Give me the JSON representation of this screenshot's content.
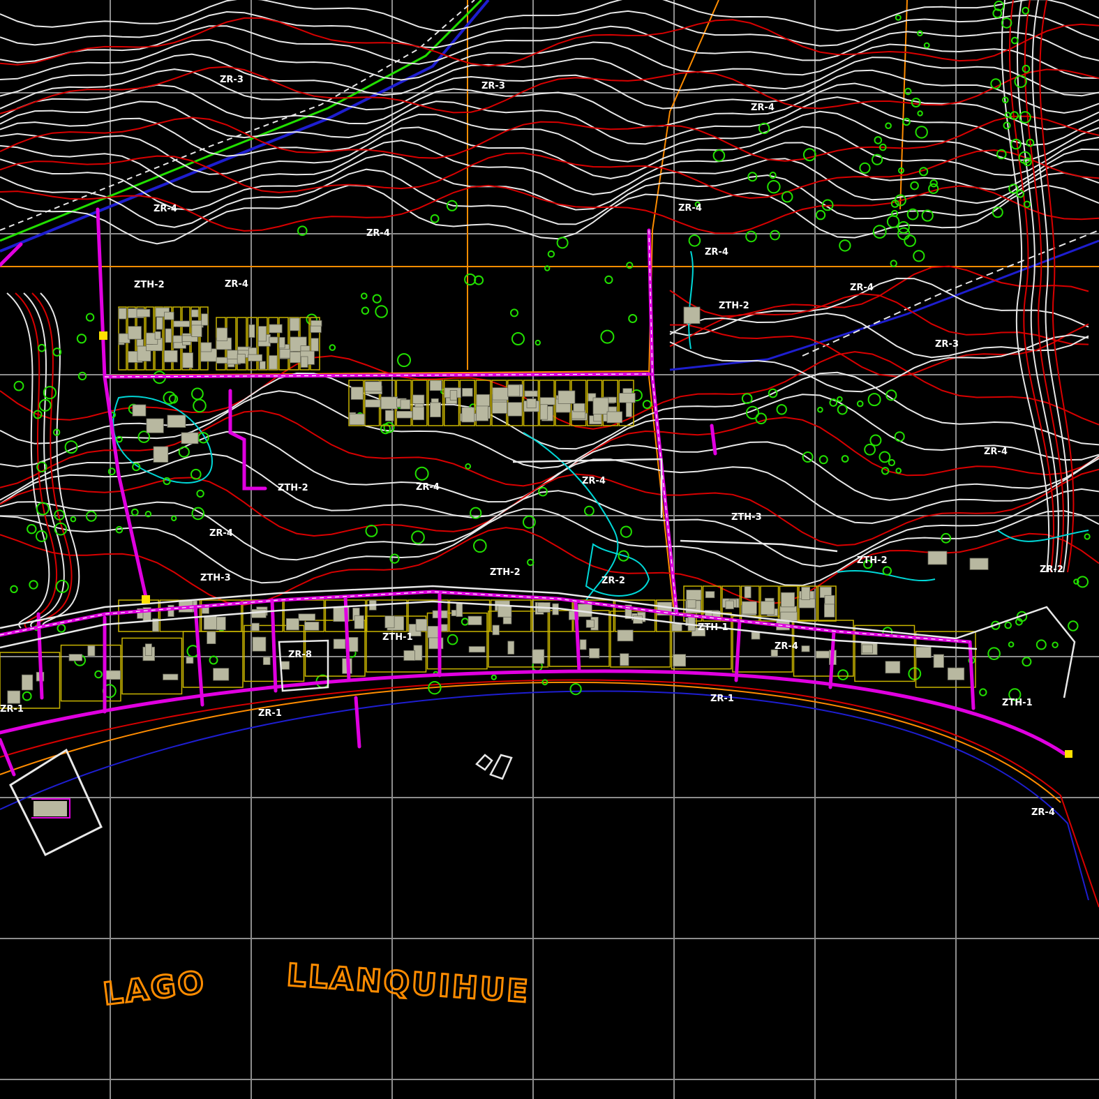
{
  "map": {
    "lake_words": [
      "LAGO",
      "LLANQUIHUE"
    ],
    "zone_labels": [
      "ZR-3",
      "ZR-3",
      "ZR-4",
      "ZR-4",
      "ZR-4",
      "ZR-4",
      "ZR-4",
      "ZR-4",
      "ZR-4",
      "ZR-4",
      "ZR-4",
      "ZR-4",
      "ZR-4",
      "ZR-4",
      "ZR-1",
      "ZR-1",
      "ZR-1",
      "ZR-4",
      "ZR-2",
      "ZR-2",
      "ZR-3",
      "ZR-8",
      "ZTH-2",
      "ZTH-2",
      "ZTH-2",
      "ZTH-2",
      "ZTH-2",
      "ZTH-1",
      "ZTH-1",
      "ZTH-1",
      "ZTH-3",
      "ZTH-3"
    ],
    "colors": {
      "background": "#000000",
      "grid": "#bdbdbd",
      "contour_major": "#e8e8e8",
      "contour_red": "#d80000",
      "vegetation": "#22e000",
      "roads": "#e000e0",
      "highway": "#1e1ed0",
      "parcels": "#c8b400",
      "zone_boundary": "#ff8c00",
      "buildings": "#b8b8a0",
      "streams": "#00d8d8",
      "lake_label": "#ff8c00"
    }
  }
}
